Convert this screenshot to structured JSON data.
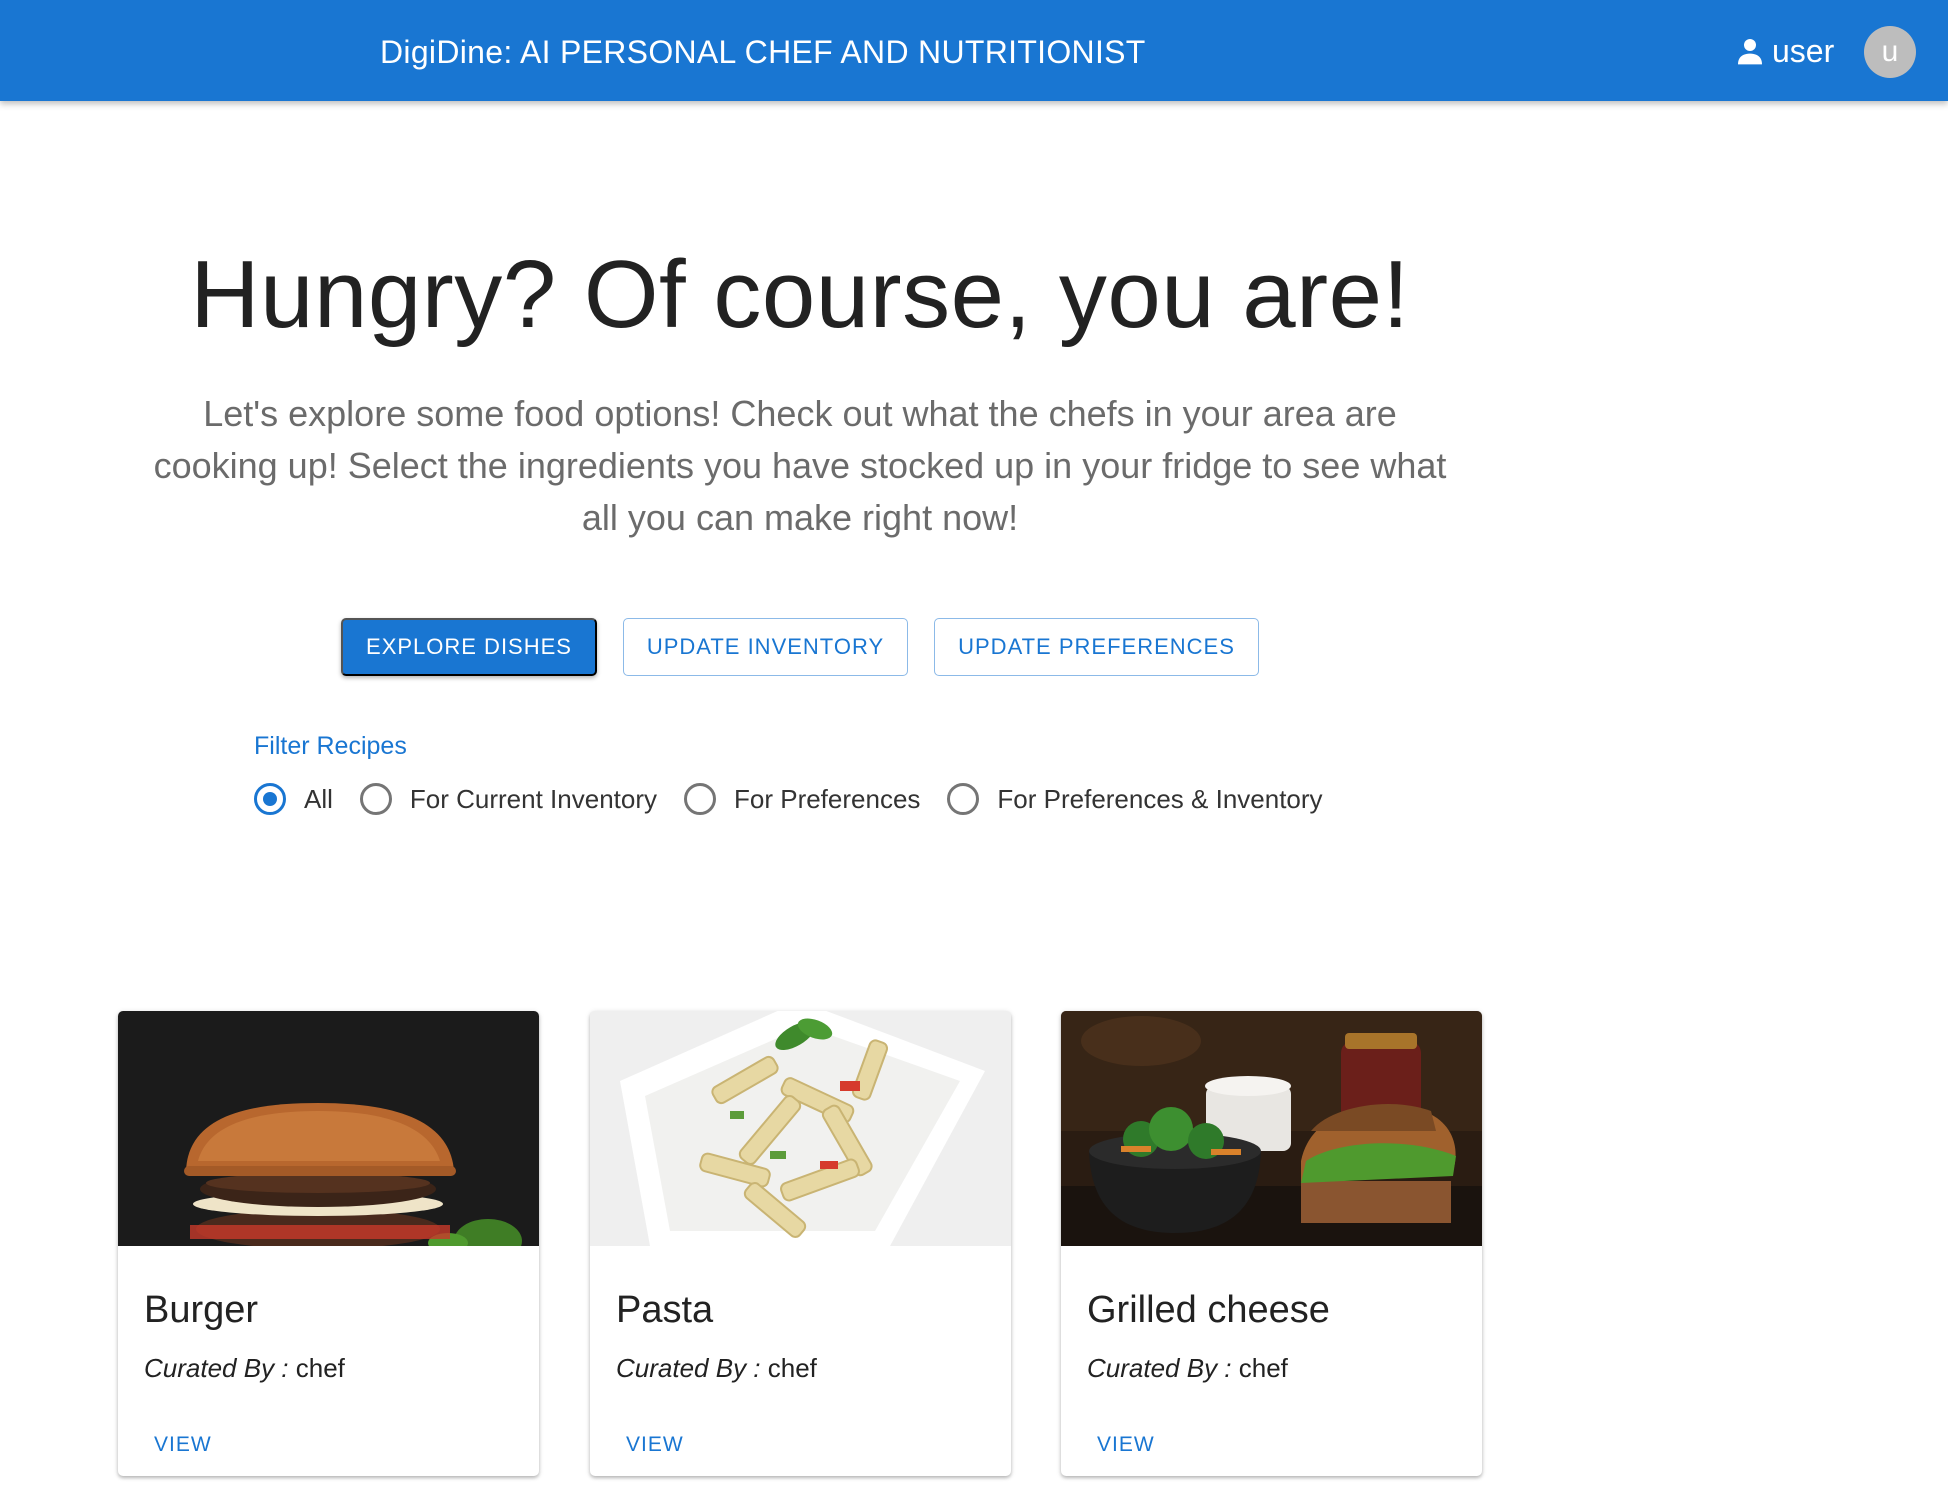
{
  "appbar": {
    "title": "DigiDine: AI PERSONAL CHEF AND NUTRITIONIST",
    "username": "user",
    "avatar_letter": "u",
    "user_icon": "person-icon"
  },
  "hero": {
    "title": "Hungry? Of course, you are!",
    "subtitle": "Let's explore some food options! Check out what the chefs in your area are cooking up! Select the ingredients you have stocked up in your fridge to see what all you can make right now!"
  },
  "actions": {
    "explore": "EXPLORE DISHES",
    "update_inventory": "UPDATE INVENTORY",
    "update_preferences": "UPDATE PREFERENCES"
  },
  "filter": {
    "label": "Filter Recipes",
    "selected": "All",
    "options": [
      "All",
      "For Current Inventory",
      "For Preferences",
      "For Preferences & Inventory"
    ]
  },
  "cards": [
    {
      "title": "Burger",
      "curated_label": "Curated By :",
      "curated_by": "chef",
      "action": "VIEW",
      "image": "burger-photo"
    },
    {
      "title": "Pasta",
      "curated_label": "Curated By :",
      "curated_by": "chef",
      "action": "VIEW",
      "image": "pasta-photo"
    },
    {
      "title": "Grilled cheese",
      "curated_label": "Curated By :",
      "curated_by": "chef",
      "action": "VIEW",
      "image": "grilled-sandwich-photo"
    }
  ],
  "colors": {
    "primary": "#1976d2",
    "avatar": "#bdbdbd",
    "subtitle_text": "#6b6b6b"
  }
}
